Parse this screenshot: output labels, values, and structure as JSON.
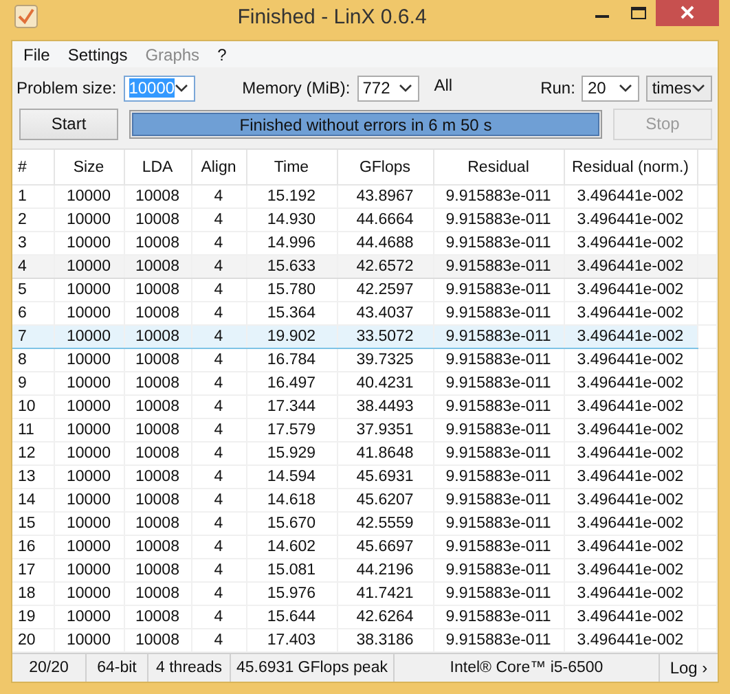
{
  "window": {
    "title": "Finished - LinX 0.6.4"
  },
  "menu": [
    {
      "label": "File",
      "disabled": false
    },
    {
      "label": "Settings",
      "disabled": false
    },
    {
      "label": "Graphs",
      "disabled": true
    },
    {
      "label": "?",
      "disabled": false
    }
  ],
  "settings": {
    "problem_size_label": "Problem size:",
    "problem_size": "10000",
    "memory_label": "Memory (MiB):",
    "memory": "772",
    "all_label": "All",
    "run_label": "Run:",
    "run": "20",
    "run_unit": "times"
  },
  "actions": {
    "start": {
      "label": "Start",
      "disabled": false
    },
    "progress": {
      "text": "Finished without errors in 6 m 50 s",
      "level": 1
    },
    "stop": {
      "label": "Stop",
      "disabled": true
    }
  },
  "table": {
    "columns": [
      "#",
      "Size",
      "LDA",
      "Align",
      "Time",
      "GFlops",
      "Residual",
      "Residual (norm.)"
    ],
    "rows": [
      {
        "cells": [
          "1",
          "10000",
          "10008",
          "4",
          "15.192",
          "43.8967",
          "9.915883e-011",
          "3.496441e-002"
        ],
        "selected": false,
        "hovered": false
      },
      {
        "cells": [
          "2",
          "10000",
          "10008",
          "4",
          "14.930",
          "44.6664",
          "9.915883e-011",
          "3.496441e-002"
        ],
        "selected": false,
        "hovered": false
      },
      {
        "cells": [
          "3",
          "10000",
          "10008",
          "4",
          "14.996",
          "44.4688",
          "9.915883e-011",
          "3.496441e-002"
        ],
        "selected": false,
        "hovered": false
      },
      {
        "cells": [
          "4",
          "10000",
          "10008",
          "4",
          "15.633",
          "42.6572",
          "9.915883e-011",
          "3.496441e-002"
        ],
        "selected": false,
        "hovered": true
      },
      {
        "cells": [
          "5",
          "10000",
          "10008",
          "4",
          "15.780",
          "42.2597",
          "9.915883e-011",
          "3.496441e-002"
        ],
        "selected": false,
        "hovered": false
      },
      {
        "cells": [
          "6",
          "10000",
          "10008",
          "4",
          "15.364",
          "43.4037",
          "9.915883e-011",
          "3.496441e-002"
        ],
        "selected": false,
        "hovered": false
      },
      {
        "cells": [
          "7",
          "10000",
          "10008",
          "4",
          "19.902",
          "33.5072",
          "9.915883e-011",
          "3.496441e-002"
        ],
        "selected": true,
        "hovered": false
      },
      {
        "cells": [
          "8",
          "10000",
          "10008",
          "4",
          "16.784",
          "39.7325",
          "9.915883e-011",
          "3.496441e-002"
        ],
        "selected": false,
        "hovered": false
      },
      {
        "cells": [
          "9",
          "10000",
          "10008",
          "4",
          "16.497",
          "40.4231",
          "9.915883e-011",
          "3.496441e-002"
        ],
        "selected": false,
        "hovered": false
      },
      {
        "cells": [
          "10",
          "10000",
          "10008",
          "4",
          "17.344",
          "38.4493",
          "9.915883e-011",
          "3.496441e-002"
        ],
        "selected": false,
        "hovered": false
      },
      {
        "cells": [
          "11",
          "10000",
          "10008",
          "4",
          "17.579",
          "37.9351",
          "9.915883e-011",
          "3.496441e-002"
        ],
        "selected": false,
        "hovered": false
      },
      {
        "cells": [
          "12",
          "10000",
          "10008",
          "4",
          "15.929",
          "41.8648",
          "9.915883e-011",
          "3.496441e-002"
        ],
        "selected": false,
        "hovered": false
      },
      {
        "cells": [
          "13",
          "10000",
          "10008",
          "4",
          "14.594",
          "45.6931",
          "9.915883e-011",
          "3.496441e-002"
        ],
        "selected": false,
        "hovered": false
      },
      {
        "cells": [
          "14",
          "10000",
          "10008",
          "4",
          "14.618",
          "45.6207",
          "9.915883e-011",
          "3.496441e-002"
        ],
        "selected": false,
        "hovered": false
      },
      {
        "cells": [
          "15",
          "10000",
          "10008",
          "4",
          "15.670",
          "42.5559",
          "9.915883e-011",
          "3.496441e-002"
        ],
        "selected": false,
        "hovered": false
      },
      {
        "cells": [
          "16",
          "10000",
          "10008",
          "4",
          "14.602",
          "45.6697",
          "9.915883e-011",
          "3.496441e-002"
        ],
        "selected": false,
        "hovered": false
      },
      {
        "cells": [
          "17",
          "10000",
          "10008",
          "4",
          "15.081",
          "44.2196",
          "9.915883e-011",
          "3.496441e-002"
        ],
        "selected": false,
        "hovered": false
      },
      {
        "cells": [
          "18",
          "10000",
          "10008",
          "4",
          "15.976",
          "41.7421",
          "9.915883e-011",
          "3.496441e-002"
        ],
        "selected": false,
        "hovered": false
      },
      {
        "cells": [
          "19",
          "10000",
          "10008",
          "4",
          "15.644",
          "42.6264",
          "9.915883e-011",
          "3.496441e-002"
        ],
        "selected": false,
        "hovered": false
      },
      {
        "cells": [
          "20",
          "10000",
          "10008",
          "4",
          "17.403",
          "38.3186",
          "9.915883e-011",
          "3.496441e-002"
        ],
        "selected": false,
        "hovered": false
      }
    ]
  },
  "status_bar": {
    "progress": "20/20",
    "arch": "64-bit",
    "threads": "4 threads",
    "peak": "45.6931 GFlops peak",
    "cpu": "Intel® Core™ i5-6500",
    "log": "Log ›"
  }
}
